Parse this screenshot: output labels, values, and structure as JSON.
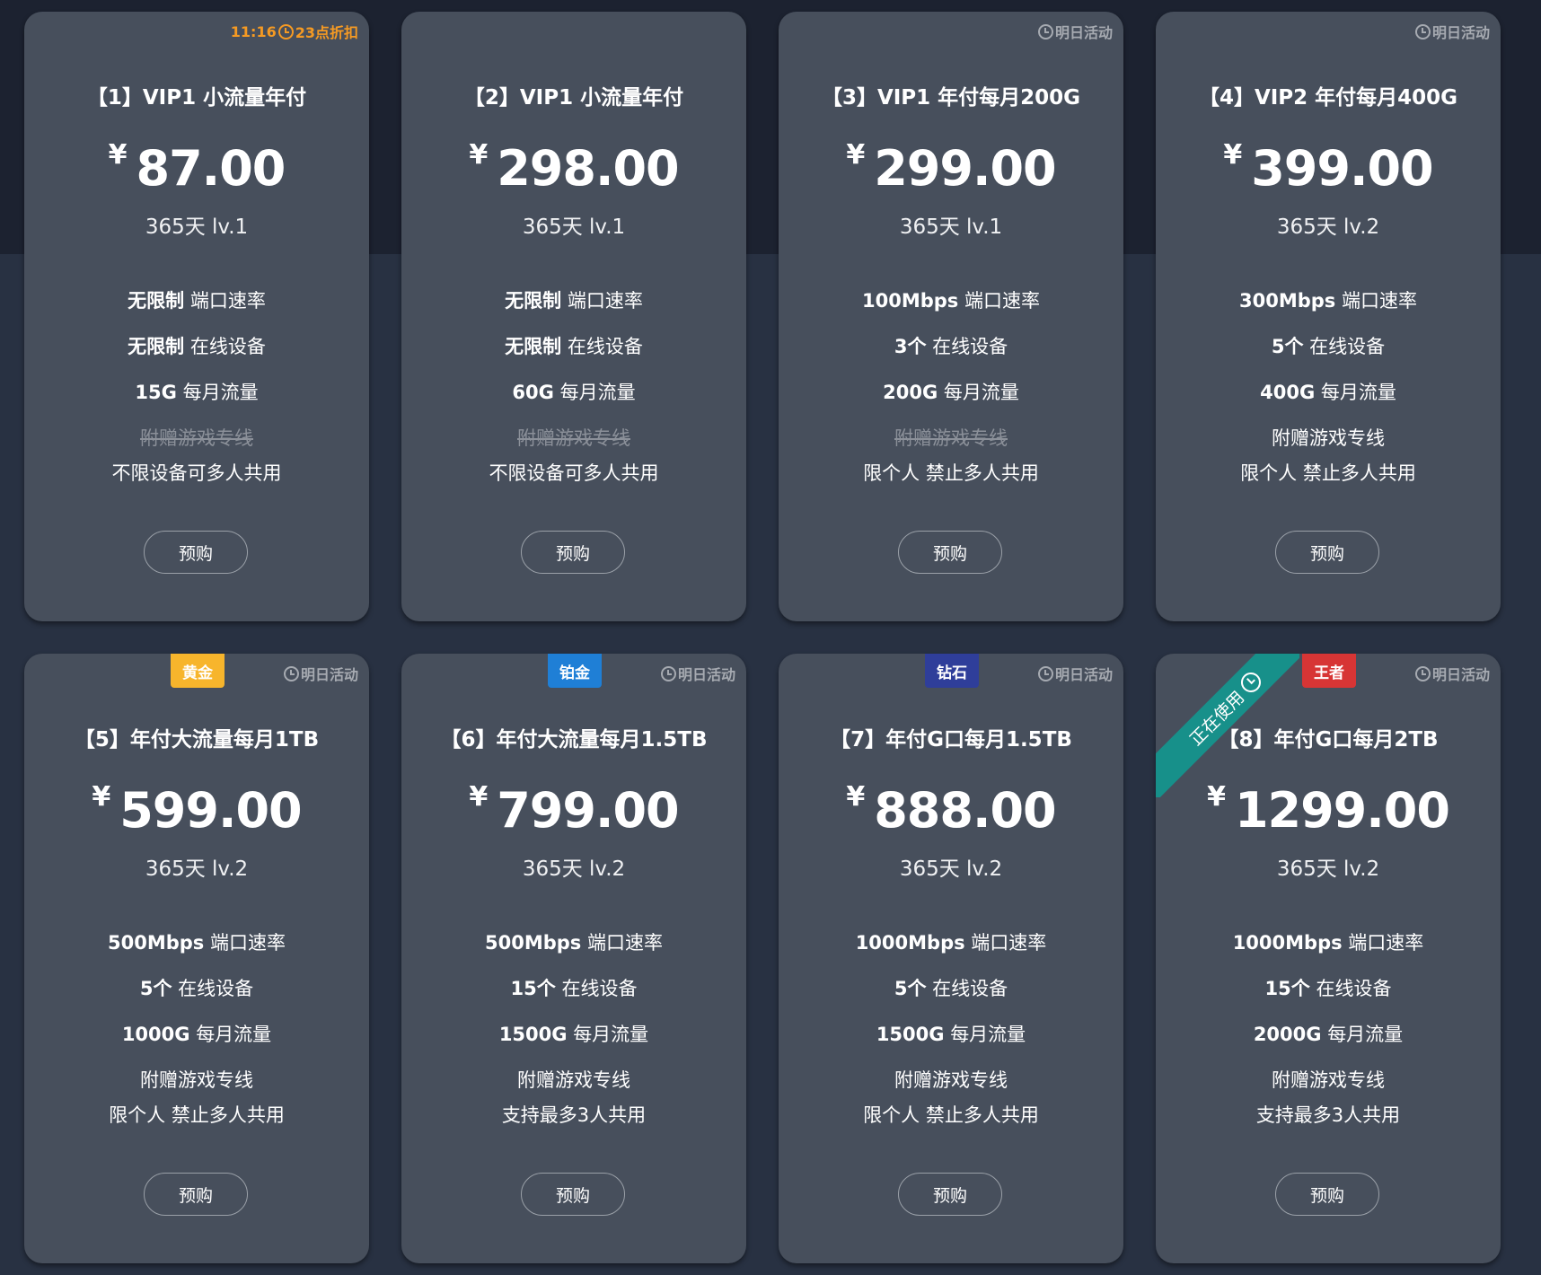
{
  "button_label": "预购",
  "colors": {
    "gold": "#f7b52c",
    "platinum": "#1f7fd6",
    "diamond": "#2f3e9a",
    "king": "#d73535",
    "ribbon": "#17908a",
    "timer_hot": "#f59a23"
  },
  "plans": [
    {
      "timer": "11:16",
      "timer_after": "23点折扣",
      "timer_hot": true,
      "title": "【1】VIP1 小流量年付",
      "currency": "¥",
      "price": "87.00",
      "duration": "365天 lv.1",
      "features": [
        {
          "bold": "无限制",
          "text": "端口速率"
        },
        {
          "bold": "无限制",
          "text": "在线设备"
        },
        {
          "bold": "15G",
          "text": "每月流量"
        },
        {
          "text": "附赠游戏专线",
          "struck": true
        },
        {
          "text": "不限设备可多人共用"
        }
      ]
    },
    {
      "timer": "",
      "timer_after": "",
      "title": "【2】VIP1 小流量年付",
      "currency": "¥",
      "price": "298.00",
      "duration": "365天 lv.1",
      "features": [
        {
          "bold": "无限制",
          "text": "端口速率"
        },
        {
          "bold": "无限制",
          "text": "在线设备"
        },
        {
          "bold": "60G",
          "text": "每月流量"
        },
        {
          "text": "附赠游戏专线",
          "struck": true
        },
        {
          "text": "不限设备可多人共用"
        }
      ]
    },
    {
      "timer": "明日活动",
      "title": "【3】VIP1 年付每月200G",
      "currency": "¥",
      "price": "299.00",
      "duration": "365天 lv.1",
      "features": [
        {
          "bold": "100Mbps",
          "text": "端口速率"
        },
        {
          "bold": "3个",
          "text": "在线设备"
        },
        {
          "bold": "200G",
          "text": "每月流量"
        },
        {
          "text": "附赠游戏专线",
          "struck": true
        },
        {
          "text": "限个人 禁止多人共用"
        }
      ]
    },
    {
      "timer": "明日活动",
      "title": "【4】VIP2 年付每月400G",
      "currency": "¥",
      "price": "399.00",
      "duration": "365天 lv.2",
      "features": [
        {
          "bold": "300Mbps",
          "text": "端口速率"
        },
        {
          "bold": "5个",
          "text": "在线设备"
        },
        {
          "bold": "400G",
          "text": "每月流量"
        },
        {
          "text": "附赠游戏专线"
        },
        {
          "text": "限个人 禁止多人共用"
        }
      ]
    },
    {
      "timer": "明日活动",
      "tier": "黄金",
      "tier_color": "#f7b52c",
      "title": "【5】年付大流量每月1TB",
      "currency": "¥",
      "price": "599.00",
      "duration": "365天 lv.2",
      "features": [
        {
          "bold": "500Mbps",
          "text": "端口速率"
        },
        {
          "bold": "5个",
          "text": "在线设备"
        },
        {
          "bold": "1000G",
          "text": "每月流量"
        },
        {
          "text": "附赠游戏专线"
        },
        {
          "text": "限个人 禁止多人共用"
        }
      ]
    },
    {
      "timer": "明日活动",
      "tier": "铂金",
      "tier_color": "#1f7fd6",
      "title": "【6】年付大流量每月1.5TB",
      "currency": "¥",
      "price": "799.00",
      "duration": "365天 lv.2",
      "features": [
        {
          "bold": "500Mbps",
          "text": "端口速率"
        },
        {
          "bold": "15个",
          "text": "在线设备"
        },
        {
          "bold": "1500G",
          "text": "每月流量"
        },
        {
          "text": "附赠游戏专线"
        },
        {
          "text": "支持最多3人共用"
        }
      ]
    },
    {
      "timer": "明日活动",
      "tier": "钻石",
      "tier_color": "#2f3e9a",
      "title": "【7】年付G口每月1.5TB",
      "currency": "¥",
      "price": "888.00",
      "duration": "365天 lv.2",
      "features": [
        {
          "bold": "1000Mbps",
          "text": "端口速率"
        },
        {
          "bold": "5个",
          "text": "在线设备"
        },
        {
          "bold": "1500G",
          "text": "每月流量"
        },
        {
          "text": "附赠游戏专线"
        },
        {
          "text": "限个人 禁止多人共用"
        }
      ]
    },
    {
      "timer": "明日活动",
      "tier": "王者",
      "tier_color": "#d73535",
      "ribbon": "正在使用",
      "title": "【8】年付G口每月2TB",
      "currency": "¥",
      "price": "1299.00",
      "duration": "365天 lv.2",
      "features": [
        {
          "bold": "1000Mbps",
          "text": "端口速率"
        },
        {
          "bold": "15个",
          "text": "在线设备"
        },
        {
          "bold": "2000G",
          "text": "每月流量"
        },
        {
          "text": "附赠游戏专线"
        },
        {
          "text": "支持最多3人共用"
        }
      ]
    }
  ]
}
